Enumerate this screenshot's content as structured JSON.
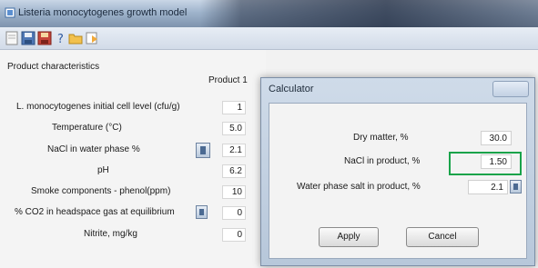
{
  "window": {
    "title": "Listeria monocytogenes growth model",
    "icon": "app-icon",
    "toolbar": [
      "new-file-icon",
      "save-icon",
      "save-as-icon",
      "help-icon",
      "open-folder-icon",
      "report-icon"
    ]
  },
  "product": {
    "group_title": "Product characteristics",
    "column_header": "Product 1",
    "rows": [
      {
        "label": "L. monocytogenes initial cell level (cfu/g)",
        "value": "1"
      },
      {
        "label": "Temperature (°C)",
        "value": "5.0"
      },
      {
        "label": "NaCl in water phase %",
        "value": "2.1"
      },
      {
        "label": "pH",
        "value": "6.2"
      },
      {
        "label": "Smoke components - phenol(ppm)",
        "value": "10"
      },
      {
        "label": "% CO2 in headspace gas at equilibrium",
        "value": "0"
      },
      {
        "label": "Nitrite, mg/kg",
        "value": "0"
      }
    ]
  },
  "calculator": {
    "title": "Calculator",
    "fields": [
      {
        "label": "Dry matter, %",
        "value": "30.0"
      },
      {
        "label": "NaCl in product, %",
        "value": "1.50"
      },
      {
        "label": "Water phase salt in product, %",
        "value": "2.1"
      }
    ],
    "apply_label": "Apply",
    "cancel_label": "Cancel",
    "highlight_color": "#19a34a"
  }
}
